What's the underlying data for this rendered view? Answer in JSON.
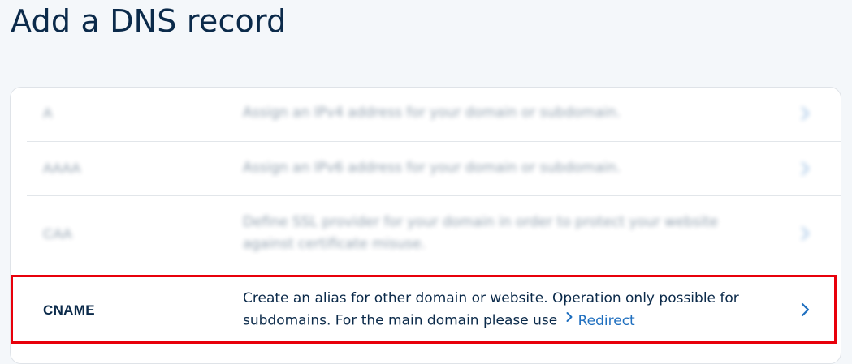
{
  "page": {
    "title": "Add a DNS record"
  },
  "records": [
    {
      "type": "A",
      "description": "Assign an IPv4 address for your domain or subdomain."
    },
    {
      "type": "AAAA",
      "description": "Assign an IPv6 address for your domain or subdomain."
    },
    {
      "type": "CAA",
      "description": "Define SSL provider for your domain in order to protect your website against certificate misuse."
    },
    {
      "type": "CNAME",
      "description_prefix": "Create an alias for other domain or website. Operation only possible for subdomains. For the main domain please use",
      "link_label": "Redirect",
      "link_icon": "chevron-right-icon"
    }
  ],
  "icons": {
    "row_chevron": "chevron-right-icon"
  },
  "colors": {
    "accent": "#1f6fbf",
    "text": "#0b2a4a",
    "highlight": "#e8000b",
    "background": "#f4f7fa"
  }
}
